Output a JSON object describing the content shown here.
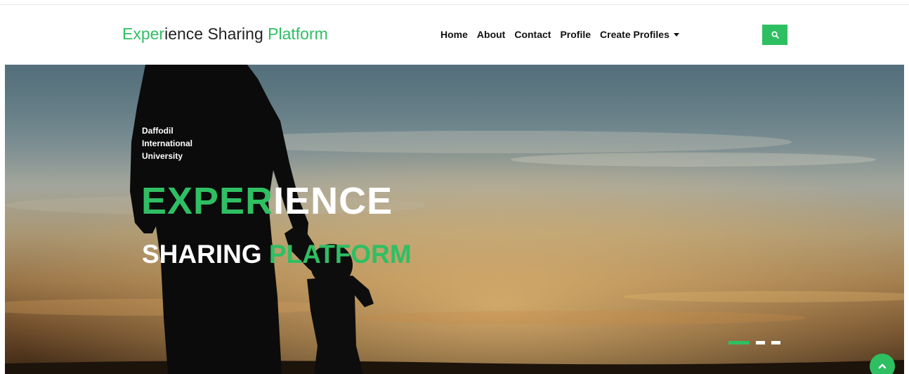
{
  "navbar": {
    "brand": {
      "part1": "Exper",
      "part2": "ience Sharing ",
      "part3": "Platform"
    },
    "links": [
      "Home",
      "About",
      "Contact",
      "Profile",
      "Create Profiles"
    ],
    "search_icon": "search-icon"
  },
  "hero": {
    "university_lines": [
      "Daffodil",
      "International",
      "University"
    ],
    "title_green": "EXPER",
    "title_white": "IENCE",
    "subtitle_white": "SHARING ",
    "subtitle_green": "PLATFORM",
    "slides": 3,
    "active_slide": 1
  },
  "colors": {
    "accent": "#2fbf63",
    "text": "#222222",
    "white": "#ffffff"
  },
  "icons": {
    "search": "search-icon",
    "scroll_top": "chevron-up-icon",
    "dropdown": "caret-down-icon"
  }
}
